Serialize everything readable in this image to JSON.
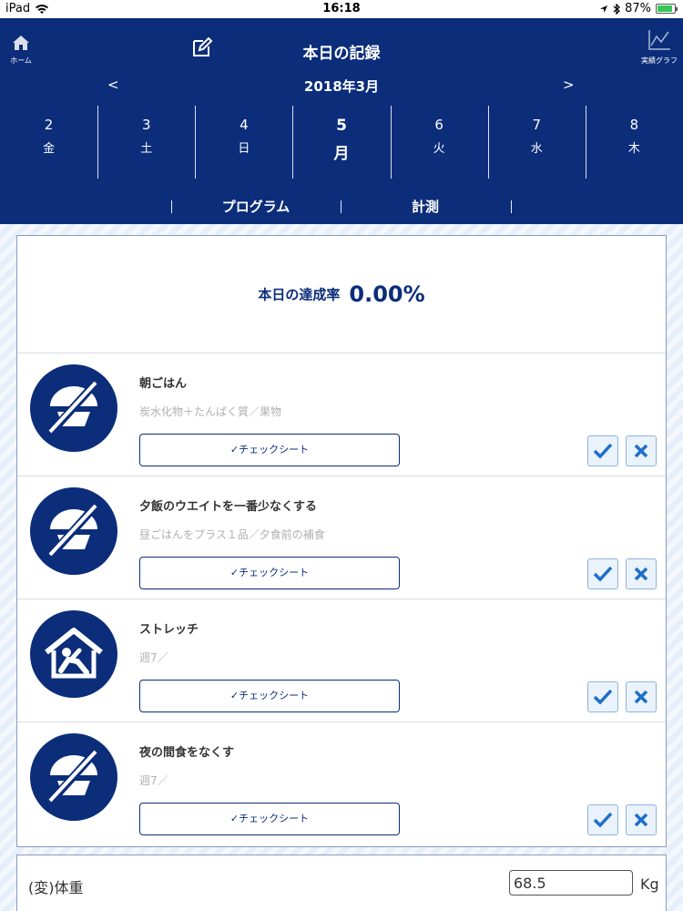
{
  "status": {
    "device": "iPad",
    "time": "16:18",
    "battery": "87%"
  },
  "header": {
    "home_label": "ホーム",
    "title": "本日の記録",
    "graph_label": "実績グラフ",
    "prev": "<",
    "next": ">",
    "month": "2018年3月"
  },
  "days": [
    {
      "num": "2",
      "weekday": "金"
    },
    {
      "num": "3",
      "weekday": "土"
    },
    {
      "num": "4",
      "weekday": "日"
    },
    {
      "num": "5",
      "weekday": "月"
    },
    {
      "num": "6",
      "weekday": "火"
    },
    {
      "num": "7",
      "weekday": "水"
    },
    {
      "num": "8",
      "weekday": "木"
    }
  ],
  "tabs": [
    "プログラム",
    "計測"
  ],
  "rate": {
    "label": "本日の達成率",
    "value": "0.00%"
  },
  "items": [
    {
      "name": "朝ごはん",
      "sub": "炭水化物＋たんぱく質／果物",
      "button": "✓チェックシート",
      "icon": "no-food-icon"
    },
    {
      "name": "夕飯のウエイトを一番少なくする",
      "sub": "昼ごはんをプラス１品／夕食前の補食",
      "button": "✓チェックシート",
      "icon": "no-food-icon"
    },
    {
      "name": "ストレッチ",
      "sub": "週7／",
      "button": "✓チェックシート",
      "icon": "home-stretch-icon"
    },
    {
      "name": "夜の間食をなくす",
      "sub": "週7／",
      "button": "✓チェックシート",
      "icon": "no-food-icon"
    }
  ],
  "weight": {
    "label": "(変)体重",
    "value": "68.5",
    "unit": "Kg"
  },
  "colors": {
    "navy": "#0b2d7a",
    "check_blue": "#1e6fc9"
  }
}
